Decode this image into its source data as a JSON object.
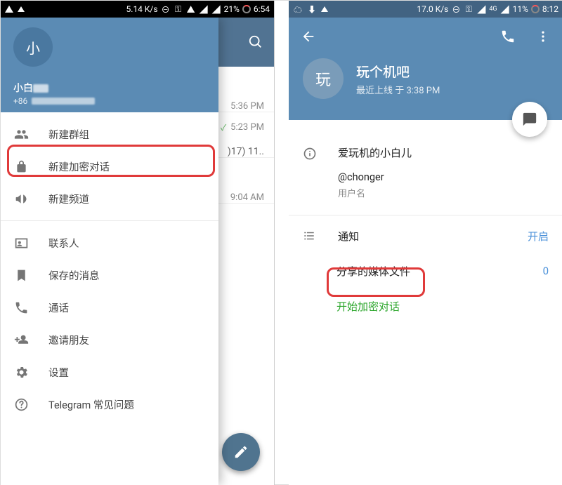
{
  "left": {
    "status": {
      "speed": "5.14 K/s",
      "battery": "21%",
      "time": "6:54"
    },
    "bg": {
      "search_label": "search",
      "chats": [
        {
          "time": "5:36 PM",
          "checks": false,
          "extra": ""
        },
        {
          "time": "5:23 PM",
          "checks": true,
          "extra": ")17) 11.."
        },
        {
          "time": "9:04 AM",
          "checks": false,
          "extra": ""
        }
      ]
    },
    "drawer": {
      "avatar_letter": "小",
      "name_prefix": "小白",
      "phone_prefix": "+86",
      "items": [
        {
          "key": "new-group",
          "label": "新建群组",
          "icon": "group"
        },
        {
          "key": "new-secret",
          "label": "新建加密对话",
          "icon": "lock"
        },
        {
          "key": "new-channel",
          "label": "新建频道",
          "icon": "megaphone"
        },
        {
          "key": "_divider"
        },
        {
          "key": "contacts",
          "label": "联系人",
          "icon": "person"
        },
        {
          "key": "saved",
          "label": "保存的消息",
          "icon": "bookmark"
        },
        {
          "key": "calls",
          "label": "通话",
          "icon": "phone"
        },
        {
          "key": "invite",
          "label": "邀请朋友",
          "icon": "personadd"
        },
        {
          "key": "settings",
          "label": "设置",
          "icon": "gear"
        },
        {
          "key": "faq",
          "label": "Telegram 常见问题",
          "icon": "help"
        }
      ]
    }
  },
  "right": {
    "status": {
      "speed": "17.0 K/s",
      "net": "4G",
      "battery": "11%",
      "time": "8:12"
    },
    "header": {
      "avatar_letter": "玩",
      "title": "玩个机吧",
      "subtitle": "最近上线 于 3:38 PM"
    },
    "info": {
      "display_name": "爱玩机的小白儿",
      "username": "@chonger",
      "username_label": "用户名"
    },
    "rows": {
      "notifications_label": "通知",
      "notifications_value": "开启",
      "shared_media_label": "分享的媒体文件",
      "shared_media_value": "0",
      "start_secret_label": "开始加密对话"
    }
  }
}
